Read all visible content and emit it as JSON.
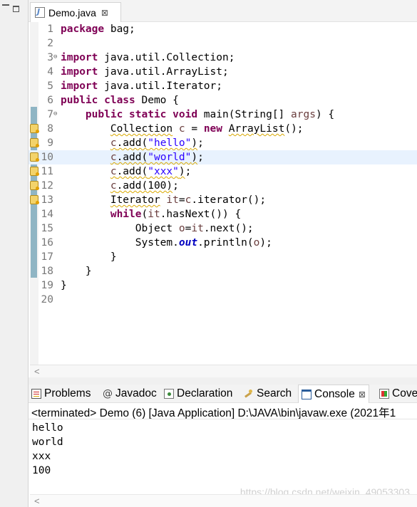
{
  "editor": {
    "tab_label": "Demo.java",
    "close_glyph": "⊠",
    "lines": [
      {
        "num": "1",
        "html": "<span class=\"kw\">package</span> bag;"
      },
      {
        "num": "2",
        "html": ""
      },
      {
        "num": "3",
        "html": "<span class=\"kw\">import</span> java.util.Collection;",
        "fold": "⊖"
      },
      {
        "num": "4",
        "html": "<span class=\"kw\">import</span> java.util.ArrayList;"
      },
      {
        "num": "5",
        "html": "<span class=\"kw\">import</span> java.util.Iterator;"
      },
      {
        "num": "6",
        "html": "<span class=\"kw\">public class</span> Demo {"
      },
      {
        "num": "7",
        "html": "    <span class=\"kw\">public static void</span> main(String[] <span class=\"var\">args</span>) {",
        "fold": "⊖"
      },
      {
        "num": "8",
        "warn": true,
        "html": "        <span class=\"wavy\">Collection</span> <span class=\"var\">c</span> = <span class=\"kw\">new</span> <span class=\"wavy\">ArrayList</span>();"
      },
      {
        "num": "9",
        "warn": true,
        "html": "        <span class=\"wavy\"><span class=\"var\">c</span>.add(<span class=\"str\">\"hello\"</span>)</span>;"
      },
      {
        "num": "10",
        "warn": true,
        "current": true,
        "html": "        <span class=\"wavy\"><span class=\"var\">c</span>.add(<span class=\"str\">\"world\"</span>)</span>;"
      },
      {
        "num": "11",
        "warn": true,
        "html": "        <span class=\"wavy\"><span class=\"var\">c</span>.add(<span class=\"str\">\"xxx\"</span>)</span>;"
      },
      {
        "num": "12",
        "warn": true,
        "html": "        <span class=\"wavy\"><span class=\"var\">c</span>.add(100)</span>;"
      },
      {
        "num": "13",
        "warn": true,
        "html": "        <span class=\"wavy\">Iterator</span> <span class=\"var\">it</span>=<span class=\"var\">c</span>.iterator();"
      },
      {
        "num": "14",
        "html": "        <span class=\"kw\">while</span>(<span class=\"var\">it</span>.hasNext()) {"
      },
      {
        "num": "15",
        "html": "            Object <span class=\"var\">o</span>=<span class=\"var\">it</span>.next();"
      },
      {
        "num": "16",
        "html": "            System.<span class=\"fld\">out</span>.println(<span class=\"var\">o</span>);"
      },
      {
        "num": "17",
        "html": "        }"
      },
      {
        "num": "18",
        "html": "    }"
      },
      {
        "num": "19",
        "html": "}"
      },
      {
        "num": "20",
        "html": ""
      }
    ]
  },
  "views": {
    "tabs": [
      {
        "label": "Problems",
        "icon": "problems-icon"
      },
      {
        "label": "Javadoc",
        "icon": "javadoc-icon",
        "glyph": "@"
      },
      {
        "label": "Declaration",
        "icon": "declaration-icon"
      },
      {
        "label": "Search",
        "icon": "search-icon"
      },
      {
        "label": "Console",
        "icon": "console-icon",
        "active": true
      },
      {
        "label": "Cove",
        "icon": "coverage-icon"
      }
    ]
  },
  "console": {
    "header": "<terminated> Demo (6) [Java Application] D:\\JAVA\\bin\\javaw.exe  (2021年1",
    "output": [
      "hello",
      "world",
      "xxx",
      "100"
    ]
  },
  "scroll_arrow": "<",
  "watermark": "https://blog.csdn.net/weixin_49053303"
}
